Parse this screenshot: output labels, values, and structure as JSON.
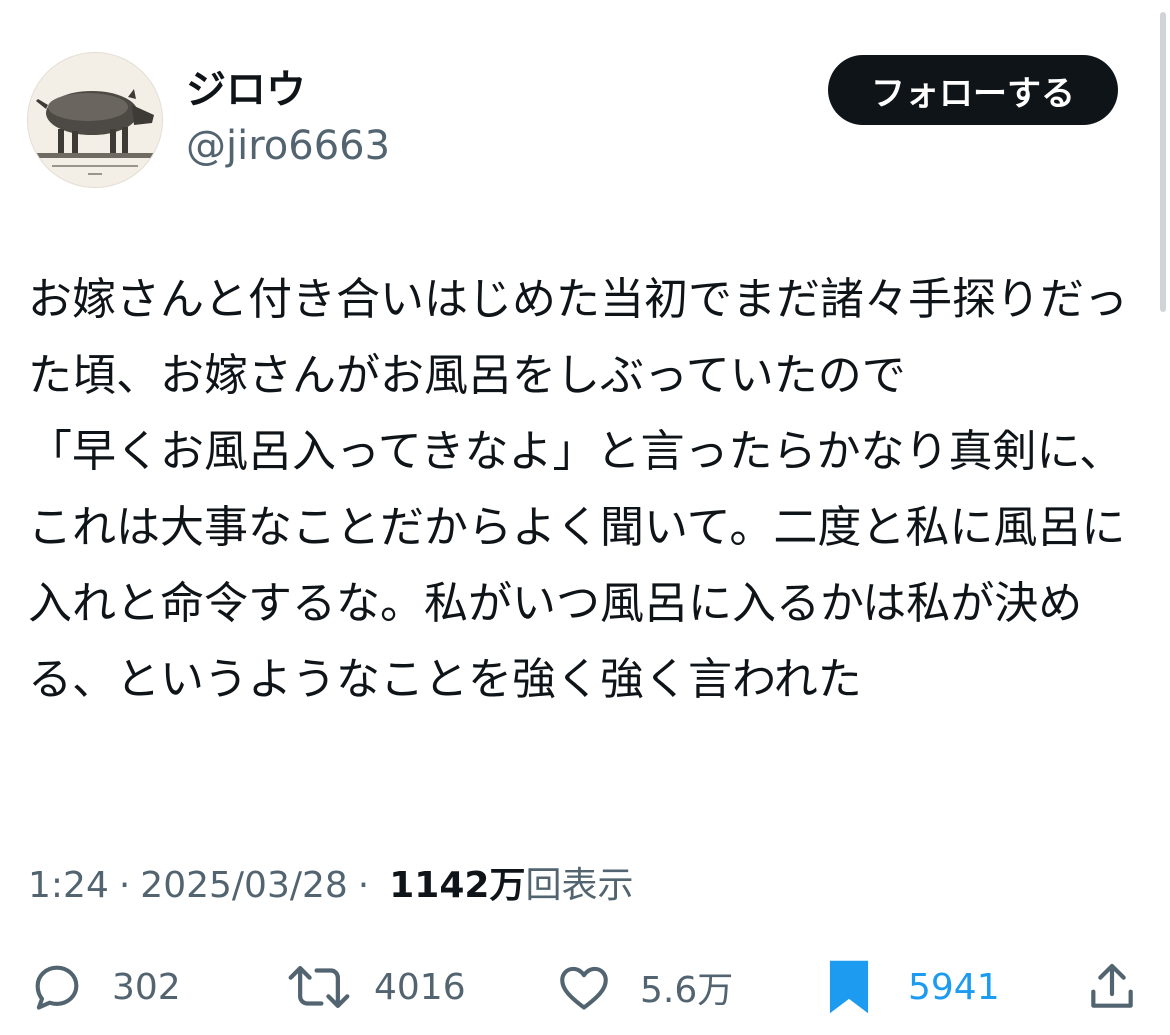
{
  "author": {
    "display_name": "ジロウ",
    "handle": "@jiro6663",
    "avatar_icon": "boar-engraving-avatar"
  },
  "follow_button": {
    "label": "フォローする"
  },
  "tweet": {
    "text": "お嫁さんと付き合いはじめた当初でまだ諸々手探りだった頃、お嫁さんがお風呂をしぶっていたので\n「早くお風呂入ってきなよ」と言ったらかなり真剣に、これは大事なことだからよく聞いて。二度と私に風呂に入れと命令するな。私がいつ風呂に入るかは私が決める、というようなことを強く強く言われた"
  },
  "meta": {
    "time": "1:24",
    "separator": "·",
    "date": "2025/03/28",
    "views_count": "1142万",
    "views_label": "回表示"
  },
  "actions": {
    "reply": {
      "icon": "reply-icon",
      "count": "302"
    },
    "retweet": {
      "icon": "retweet-icon",
      "count": "4016"
    },
    "like": {
      "icon": "heart-icon",
      "count": "5.6万"
    },
    "bookmark": {
      "icon": "bookmark-icon",
      "count": "5941"
    },
    "share": {
      "icon": "share-icon"
    }
  },
  "colors": {
    "text_primary": "#0f1419",
    "text_secondary": "#536471",
    "accent": "#1d9bf0",
    "button_bg": "#0f1419"
  }
}
